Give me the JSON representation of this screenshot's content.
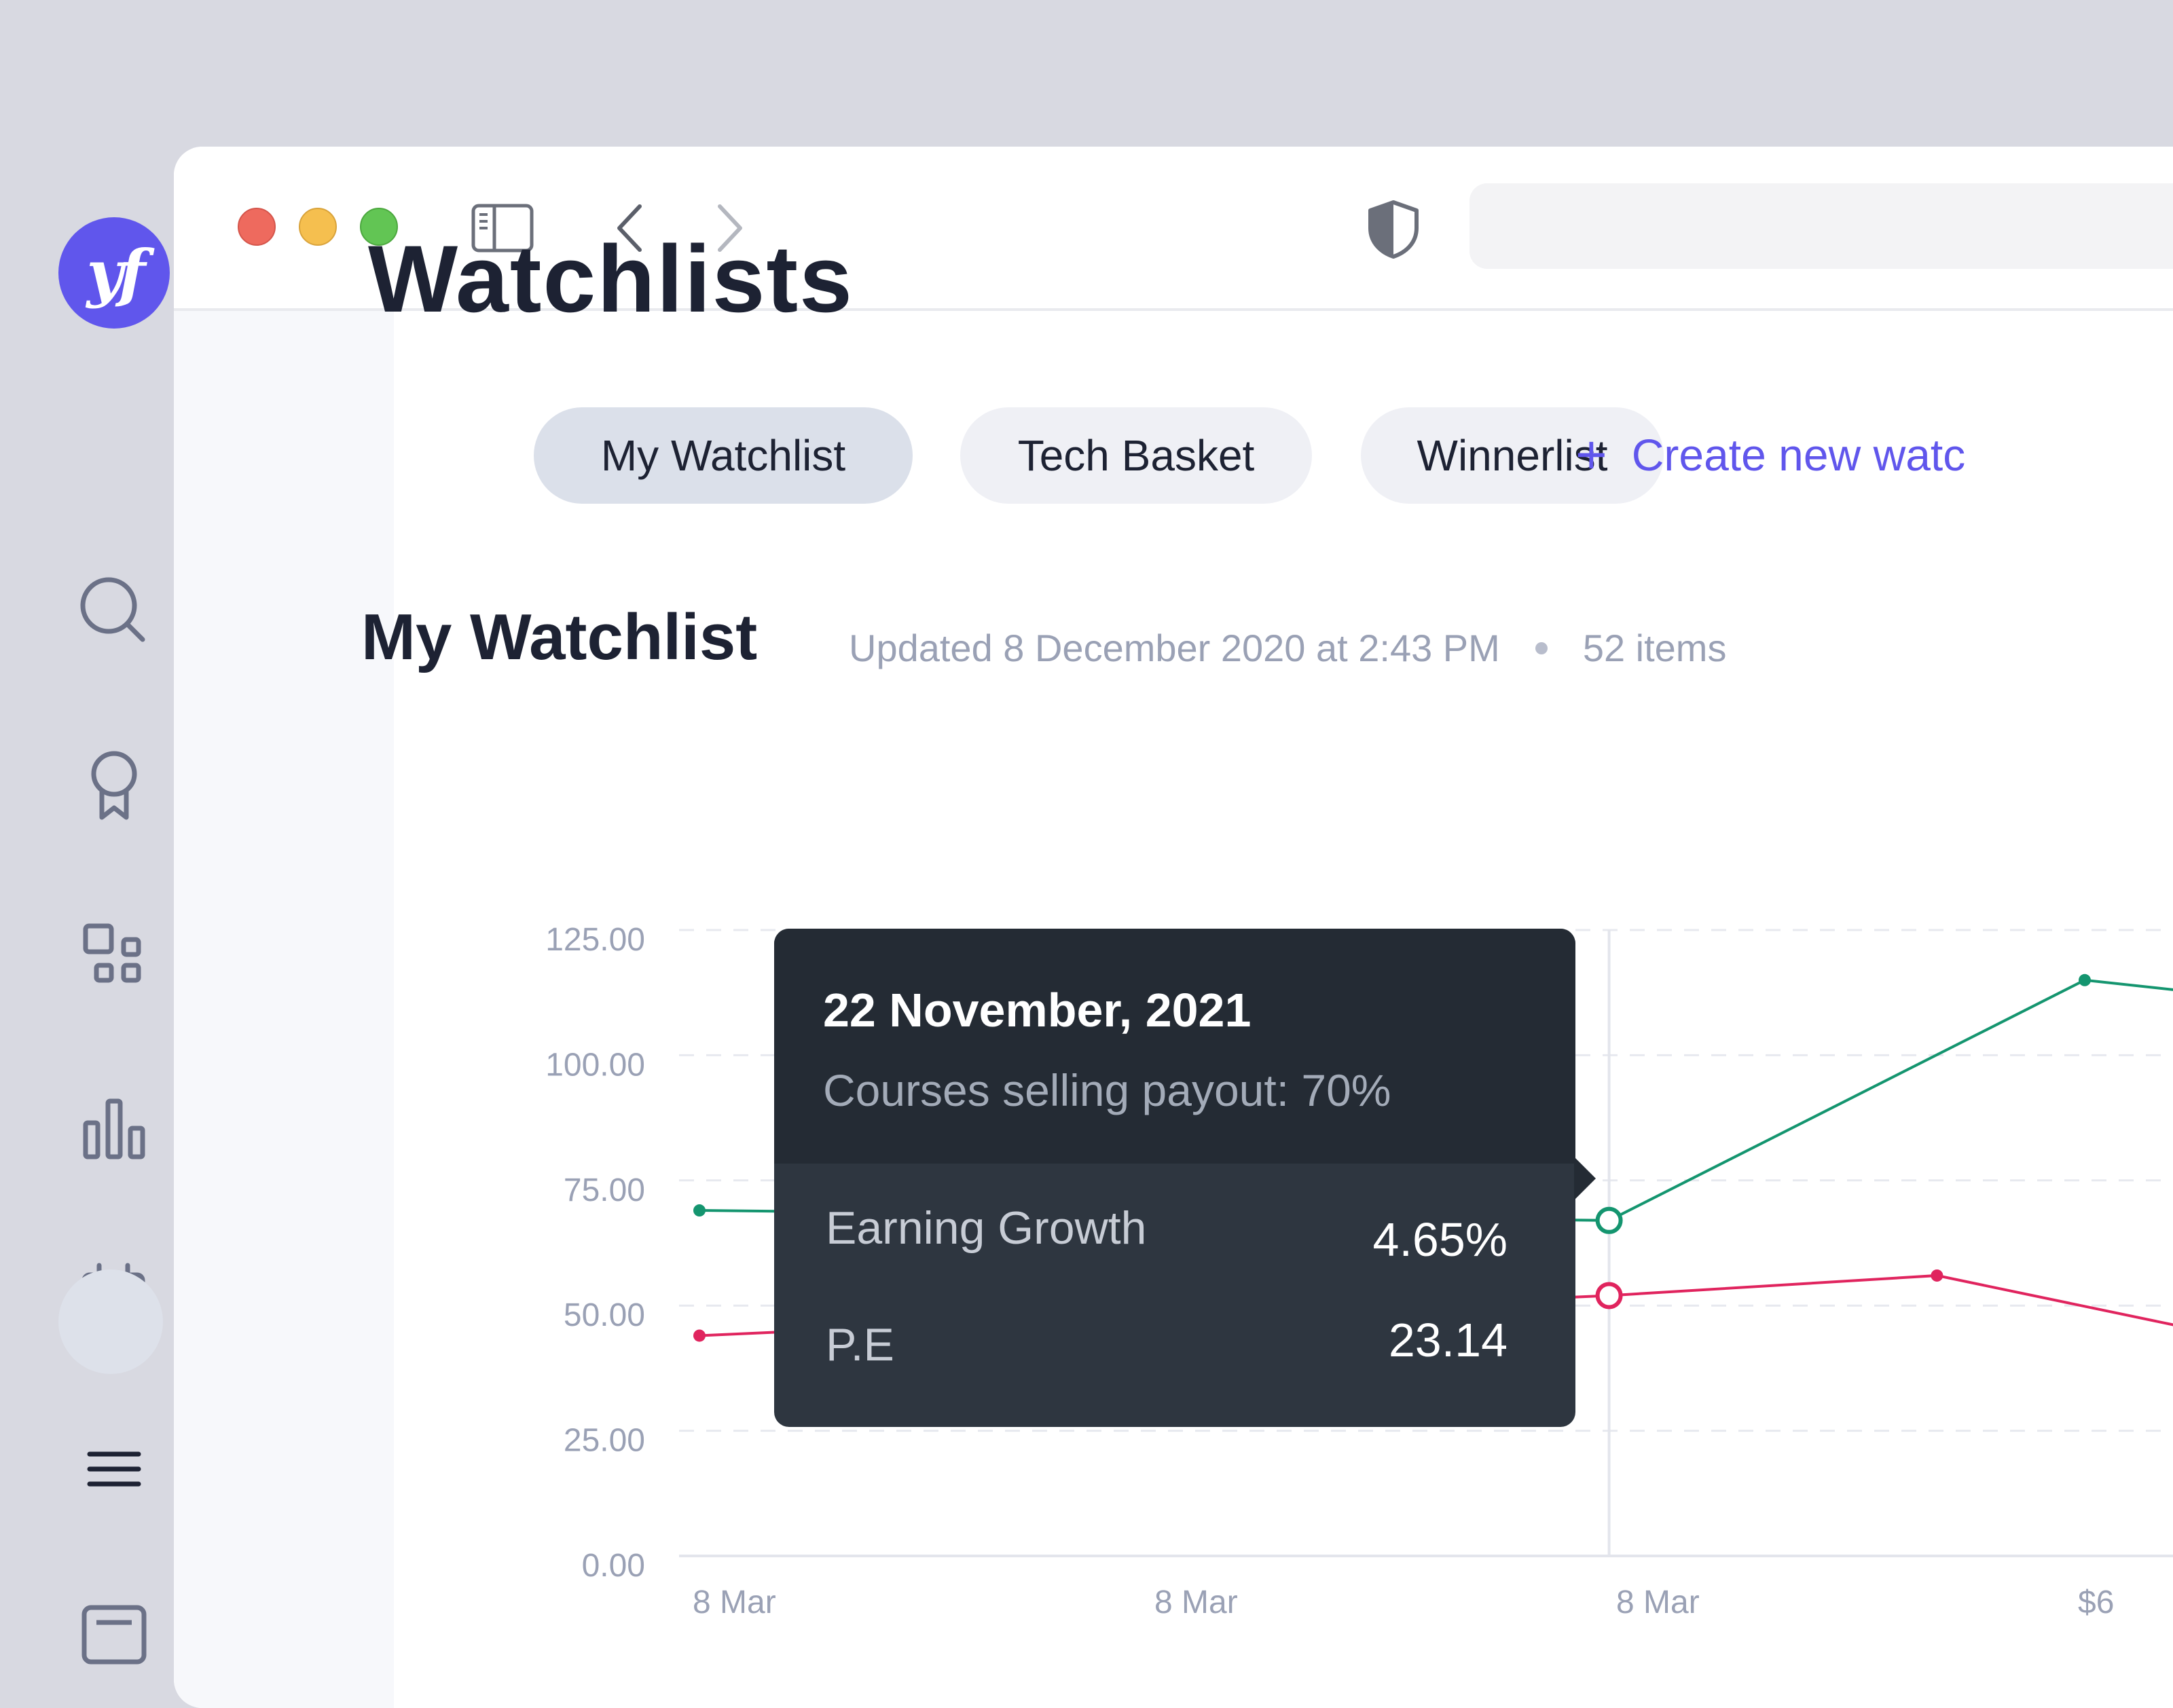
{
  "browser": {
    "icons": [
      "sidebar-toggle-icon",
      "chevron-left-icon",
      "chevron-right-icon",
      "shield-icon"
    ]
  },
  "app": {
    "logo_text": "yf",
    "rail_icons": [
      "search-icon",
      "award-icon",
      "apps-icon",
      "bar-chart-icon",
      "calendar-icon",
      "menu-icon",
      "message-icon"
    ],
    "active_rail_icon": "menu-icon"
  },
  "page": {
    "title": "Watchlists",
    "tabs": [
      {
        "label": "My Watchlist",
        "active": true
      },
      {
        "label": "Tech Basket",
        "active": false
      },
      {
        "label": "Winnerlist",
        "active": false
      }
    ],
    "create_label": "Create new watc",
    "section_title": "My Watchlist",
    "updated": "Updated 8 December 2020 at 2:43 PM",
    "items": "52 items"
  },
  "colors": {
    "accent": "#6056ec",
    "series_green": "#14956f",
    "series_red": "#e0245e",
    "tooltip_bg": "#2e3640"
  },
  "chart_data": {
    "type": "line",
    "y_ticks": [
      "125.00",
      "100.00",
      "75.00",
      "50.00",
      "25.00",
      "0.00"
    ],
    "ylim": [
      0,
      125
    ],
    "x_tick_labels": [
      "8 Mar",
      "8 Mar",
      "8 Mar",
      "$6"
    ],
    "grid": true,
    "series": [
      {
        "color": "#14956f",
        "points": [
          {
            "x": 0.0,
            "y": 69
          },
          {
            "x": 1.97,
            "y": 67
          },
          {
            "x": 3.0,
            "y": 115
          },
          {
            "x": 3.2,
            "y": 113
          }
        ]
      },
      {
        "color": "#e0245e",
        "points": [
          {
            "x": 0.0,
            "y": 44
          },
          {
            "x": 1.97,
            "y": 52
          },
          {
            "x": 2.68,
            "y": 56
          },
          {
            "x": 3.2,
            "y": 46
          }
        ]
      }
    ],
    "highlight_x": 1.97,
    "tooltip": {
      "date": "22 November, 2021",
      "subtitle": "Courses selling payout: 70%",
      "rows": [
        {
          "label": "Earning Growth",
          "value": "4.65%"
        },
        {
          "label": "P.E",
          "value": "23.14"
        }
      ]
    }
  }
}
